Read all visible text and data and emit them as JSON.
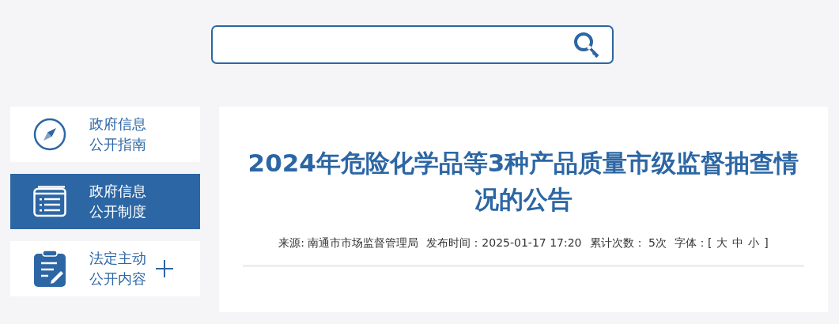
{
  "sidebar": {
    "items": [
      {
        "label": "政府信息公开指南",
        "kind": "compass",
        "selected": false,
        "expandable": false
      },
      {
        "label": "政府信息公开制度",
        "kind": "list",
        "selected": true,
        "expandable": false
      },
      {
        "label": "法定主动公开内容",
        "kind": "clipboard",
        "selected": false,
        "expandable": true
      }
    ]
  },
  "article": {
    "title": "2024年危险化学品等3种产品质量市级监督抽查情况的公告",
    "meta": {
      "source": "来源: 南通市市场监督管理局",
      "published": "发布时间：2025-01-17 17:20",
      "views": "累计次数： 5次",
      "font_label": "字体：[",
      "font_sizes": [
        "大",
        "中",
        "小"
      ],
      "font_close": "]"
    }
  }
}
